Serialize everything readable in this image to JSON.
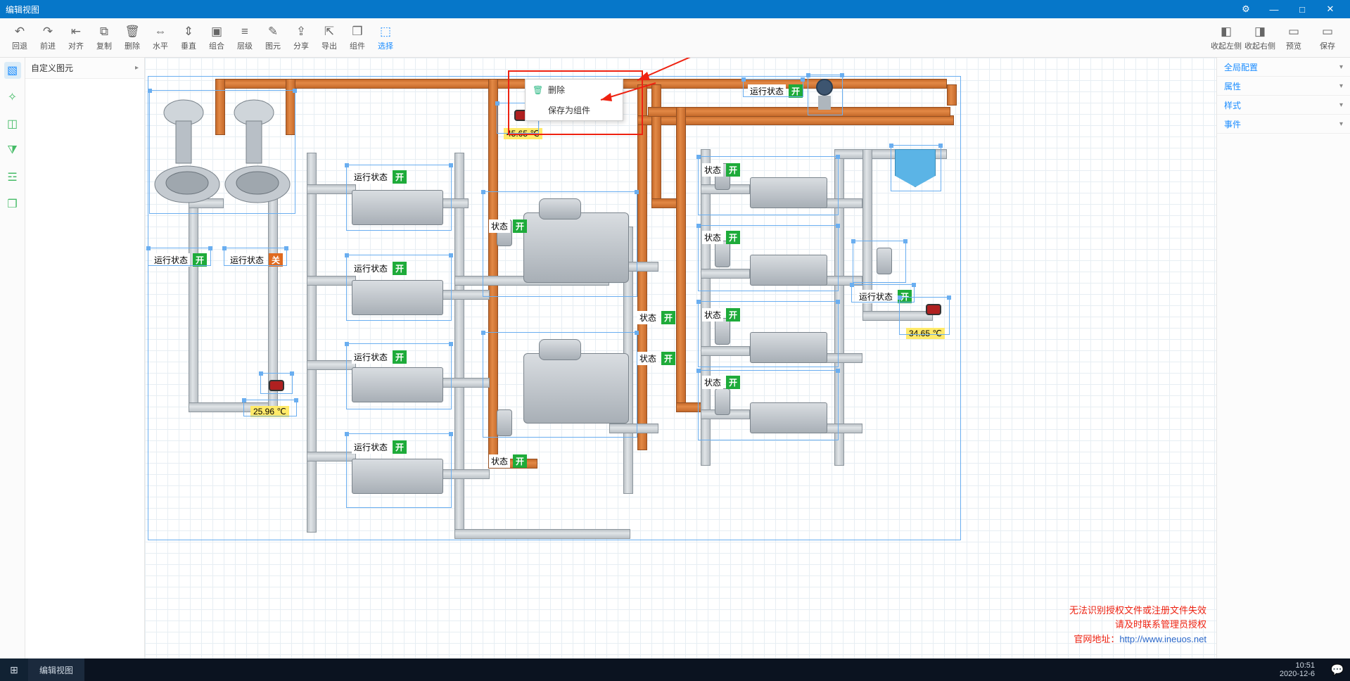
{
  "title": "编辑视图",
  "toolbar": [
    {
      "id": "undo",
      "label": "回退",
      "glyph": "↶"
    },
    {
      "id": "redo",
      "label": "前进",
      "glyph": "↷"
    },
    {
      "id": "align",
      "label": "对齐",
      "glyph": "⇤"
    },
    {
      "id": "copy",
      "label": "复制",
      "glyph": "⧉"
    },
    {
      "id": "delete",
      "label": "删除",
      "glyph": "🗑"
    },
    {
      "id": "horiz",
      "label": "水平",
      "glyph": "⇔"
    },
    {
      "id": "vert",
      "label": "垂直",
      "glyph": "⇕"
    },
    {
      "id": "group",
      "label": "组合",
      "glyph": "▣"
    },
    {
      "id": "layer",
      "label": "层级",
      "glyph": "≡"
    },
    {
      "id": "elem",
      "label": "图元",
      "glyph": "✎"
    },
    {
      "id": "share",
      "label": "分享",
      "glyph": "⇪"
    },
    {
      "id": "export",
      "label": "导出",
      "glyph": "⇱"
    },
    {
      "id": "component",
      "label": "组件",
      "glyph": "❒"
    },
    {
      "id": "select",
      "label": "选择",
      "glyph": "⬚",
      "active": true
    }
  ],
  "toolbarRight": [
    {
      "id": "collapseL",
      "label": "收起左侧",
      "glyph": "◧"
    },
    {
      "id": "collapseR",
      "label": "收起右侧",
      "glyph": "◨"
    },
    {
      "id": "preview",
      "label": "预览",
      "glyph": "▭"
    },
    {
      "id": "save",
      "label": "保存",
      "glyph": "▭"
    }
  ],
  "leftPanel": {
    "header": "自定义图元"
  },
  "rightPanel": [
    "全局配置",
    "属性",
    "样式",
    "事件"
  ],
  "contextMenu": {
    "delete": "删除",
    "saveAsComponent": "保存为组件"
  },
  "canvas": {
    "statusLabels": {
      "run": "运行状态",
      "status": "状态",
      "open": "开",
      "close": "关"
    },
    "temps": {
      "t1": "45.65 ℃",
      "t2": "25.96 ℃",
      "t3": "34.65 ℃"
    }
  },
  "warning": {
    "line1": "无法识别授权文件或注册文件失效",
    "line2": "请及时联系管理员授权",
    "line3a": "官网地址：",
    "line3b": "http://www.ineuos.net"
  },
  "taskbar": {
    "app": "编辑视图",
    "time": "10:51",
    "date": "2020-12-6"
  }
}
